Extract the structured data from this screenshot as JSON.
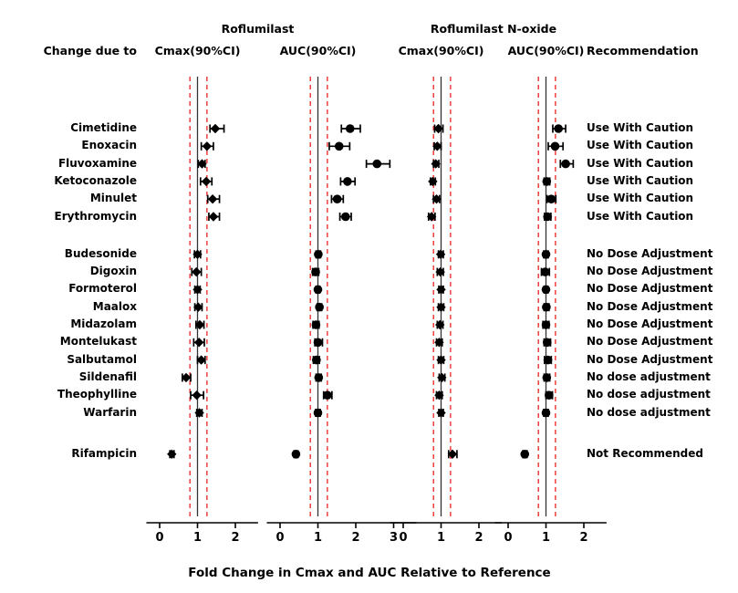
{
  "figure": {
    "group_titles": [
      {
        "label": "Roflumilast",
        "panels": [
          0,
          1
        ]
      },
      {
        "label": "Roflumilast N-oxide",
        "panels": [
          2,
          3
        ]
      }
    ],
    "column_headers": {
      "row_label": "Change due to",
      "panels": [
        "Cmax(90%CI)",
        "AUC(90%CI)",
        "Cmax(90%CI)",
        "AUC(90%CI)"
      ],
      "recommendation": "Recommendation"
    },
    "xaxis_title": "Fold Change in Cmax and AUC Relative to Reference",
    "reference_line_value": 1.0,
    "equivalence_bounds": [
      0.8,
      1.25
    ],
    "colors": {
      "reference_line": "#333333",
      "equivalence_line": "#ee2222",
      "marker": "#000000",
      "text": "#000000"
    }
  },
  "chart_data": {
    "type": "scatter",
    "title": "",
    "xlabel": "Fold Change in Cmax and AUC Relative to Reference",
    "ylabel": "",
    "grid": false,
    "legend": "none",
    "panels": [
      {
        "name": "Roflumilast Cmax(90%CI)",
        "marker": "diamond",
        "xlim": [
          -0.35,
          2.6
        ],
        "ticks": [
          0,
          1,
          2
        ]
      },
      {
        "name": "Roflumilast AUC(90%CI)",
        "marker": "circle",
        "xlim": [
          -0.35,
          3.6
        ],
        "ticks": [
          0,
          1,
          2,
          3
        ]
      },
      {
        "name": "Roflumilast N-oxide Cmax(90%CI)",
        "marker": "diamond",
        "xlim": [
          -0.35,
          2.6
        ],
        "ticks": [
          0,
          1,
          2
        ]
      },
      {
        "name": "Roflumilast N-oxide AUC(90%CI)",
        "marker": "circle",
        "xlim": [
          -0.35,
          2.6
        ],
        "ticks": [
          0,
          1,
          2
        ]
      }
    ],
    "groups": [
      {
        "recommendation": "Use With Caution",
        "rows": [
          {
            "drug": "Cimetidine",
            "recommendation": "Use With Caution",
            "values": [
              {
                "est": 1.47,
                "lo": 1.33,
                "hi": 1.7
              },
              {
                "est": 1.85,
                "lo": 1.62,
                "hi": 2.12
              },
              {
                "est": 0.93,
                "lo": 0.83,
                "hi": 1.05
              },
              {
                "est": 1.33,
                "lo": 1.18,
                "hi": 1.52
              }
            ]
          },
          {
            "drug": "Enoxacin",
            "recommendation": "Use With Caution",
            "values": [
              {
                "est": 1.25,
                "lo": 1.1,
                "hi": 1.42
              },
              {
                "est": 1.56,
                "lo": 1.3,
                "hi": 1.84
              },
              {
                "est": 0.9,
                "lo": 0.82,
                "hi": 1.0
              },
              {
                "est": 1.24,
                "lo": 1.06,
                "hi": 1.45
              }
            ]
          },
          {
            "drug": "Fluvoxamine",
            "recommendation": "Use With Caution",
            "values": [
              {
                "est": 1.12,
                "lo": 1.02,
                "hi": 1.2
              },
              {
                "est": 2.56,
                "lo": 2.28,
                "hi": 2.9
              },
              {
                "est": 0.86,
                "lo": 0.8,
                "hi": 0.94
              },
              {
                "est": 1.52,
                "lo": 1.38,
                "hi": 1.72
              }
            ]
          },
          {
            "drug": "Ketoconazole",
            "recommendation": "Use With Caution",
            "values": [
              {
                "est": 1.23,
                "lo": 1.08,
                "hi": 1.38
              },
              {
                "est": 1.78,
                "lo": 1.6,
                "hi": 1.98
              },
              {
                "est": 0.78,
                "lo": 0.72,
                "hi": 0.85
              },
              {
                "est": 1.02,
                "lo": 0.95,
                "hi": 1.1
              }
            ]
          },
          {
            "drug": "Minulet",
            "recommendation": "Use With Caution",
            "values": [
              {
                "est": 1.4,
                "lo": 1.27,
                "hi": 1.58
              },
              {
                "est": 1.51,
                "lo": 1.36,
                "hi": 1.67
              },
              {
                "est": 0.88,
                "lo": 0.8,
                "hi": 0.96
              },
              {
                "est": 1.14,
                "lo": 1.03,
                "hi": 1.26
              }
            ]
          },
          {
            "drug": "Erythromycin",
            "recommendation": "Use With Caution",
            "values": [
              {
                "est": 1.42,
                "lo": 1.3,
                "hi": 1.58
              },
              {
                "est": 1.73,
                "lo": 1.58,
                "hi": 1.88
              },
              {
                "est": 0.75,
                "lo": 0.67,
                "hi": 0.84
              },
              {
                "est": 1.04,
                "lo": 0.96,
                "hi": 1.13
              }
            ]
          }
        ]
      },
      {
        "recommendation": "No Dose Adjustment",
        "rows": [
          {
            "drug": "Budesonide",
            "recommendation": "No Dose Adjustment",
            "values": [
              {
                "est": 1.0,
                "lo": 0.92,
                "hi": 1.08
              },
              {
                "est": 1.01,
                "lo": 0.95,
                "hi": 1.07
              },
              {
                "est": 0.99,
                "lo": 0.93,
                "hi": 1.06
              },
              {
                "est": 1.0,
                "lo": 0.94,
                "hi": 1.06
              }
            ]
          },
          {
            "drug": "Digoxin",
            "recommendation": "No Dose Adjustment",
            "values": [
              {
                "est": 0.97,
                "lo": 0.85,
                "hi": 1.1
              },
              {
                "est": 0.94,
                "lo": 0.86,
                "hi": 1.02
              },
              {
                "est": 0.98,
                "lo": 0.9,
                "hi": 1.06
              },
              {
                "est": 0.98,
                "lo": 0.88,
                "hi": 1.09
              }
            ]
          },
          {
            "drug": "Formoterol",
            "recommendation": "No Dose Adjustment",
            "values": [
              {
                "est": 1.0,
                "lo": 0.93,
                "hi": 1.07
              },
              {
                "est": 1.0,
                "lo": 0.95,
                "hi": 1.05
              },
              {
                "est": 1.0,
                "lo": 0.94,
                "hi": 1.06
              },
              {
                "est": 1.0,
                "lo": 0.95,
                "hi": 1.05
              }
            ]
          },
          {
            "drug": "Maalox",
            "recommendation": "No Dose Adjustment",
            "values": [
              {
                "est": 1.02,
                "lo": 0.93,
                "hi": 1.12
              },
              {
                "est": 1.04,
                "lo": 0.98,
                "hi": 1.1
              },
              {
                "est": 1.0,
                "lo": 0.93,
                "hi": 1.07
              },
              {
                "est": 1.01,
                "lo": 0.95,
                "hi": 1.08
              }
            ]
          },
          {
            "drug": "Midazolam",
            "recommendation": "No Dose Adjustment",
            "values": [
              {
                "est": 1.06,
                "lo": 0.96,
                "hi": 1.17
              },
              {
                "est": 0.95,
                "lo": 0.87,
                "hi": 1.03
              },
              {
                "est": 0.97,
                "lo": 0.9,
                "hi": 1.05
              },
              {
                "est": 1.0,
                "lo": 0.92,
                "hi": 1.08
              }
            ]
          },
          {
            "drug": "Montelukast",
            "recommendation": "No Dose Adjustment",
            "values": [
              {
                "est": 1.04,
                "lo": 0.9,
                "hi": 1.18
              },
              {
                "est": 1.0,
                "lo": 0.92,
                "hi": 1.12
              },
              {
                "est": 0.95,
                "lo": 0.88,
                "hi": 1.03
              },
              {
                "est": 1.03,
                "lo": 0.95,
                "hi": 1.12
              }
            ]
          },
          {
            "drug": "Salbutamol",
            "recommendation": "No Dose Adjustment",
            "values": [
              {
                "est": 1.1,
                "lo": 1.0,
                "hi": 1.2
              },
              {
                "est": 0.96,
                "lo": 0.88,
                "hi": 1.04
              },
              {
                "est": 1.0,
                "lo": 0.93,
                "hi": 1.07
              },
              {
                "est": 1.05,
                "lo": 0.96,
                "hi": 1.14
              }
            ]
          },
          {
            "drug": "Sildenafil",
            "recommendation": "No dose adjustment",
            "values": [
              {
                "est": 0.7,
                "lo": 0.6,
                "hi": 0.82
              },
              {
                "est": 1.02,
                "lo": 0.95,
                "hi": 1.09
              },
              {
                "est": 1.02,
                "lo": 0.95,
                "hi": 1.1
              },
              {
                "est": 1.02,
                "lo": 0.95,
                "hi": 1.1
              }
            ]
          },
          {
            "drug": "Theophylline",
            "recommendation": "No dose adjustment",
            "values": [
              {
                "est": 0.98,
                "lo": 0.82,
                "hi": 1.16
              },
              {
                "est": 1.25,
                "lo": 1.15,
                "hi": 1.37
              },
              {
                "est": 0.95,
                "lo": 0.88,
                "hi": 1.03
              },
              {
                "est": 1.08,
                "lo": 1.0,
                "hi": 1.17
              }
            ]
          },
          {
            "drug": "Warfarin",
            "recommendation": "No dose adjustment",
            "values": [
              {
                "est": 1.05,
                "lo": 0.98,
                "hi": 1.12
              },
              {
                "est": 1.0,
                "lo": 0.94,
                "hi": 1.06
              },
              {
                "est": 1.0,
                "lo": 0.94,
                "hi": 1.06
              },
              {
                "est": 1.0,
                "lo": 0.94,
                "hi": 1.06
              }
            ]
          }
        ]
      },
      {
        "recommendation": "Not Recommended",
        "rows": [
          {
            "drug": "Rifampicin",
            "recommendation": "Not Recommended",
            "values": [
              {
                "est": 0.32,
                "lo": 0.27,
                "hi": 0.38
              },
              {
                "est": 0.42,
                "lo": 0.37,
                "hi": 0.47
              },
              {
                "est": 1.3,
                "lo": 1.2,
                "hi": 1.42
              },
              {
                "est": 0.44,
                "lo": 0.39,
                "hi": 0.5
              }
            ]
          }
        ]
      }
    ]
  }
}
